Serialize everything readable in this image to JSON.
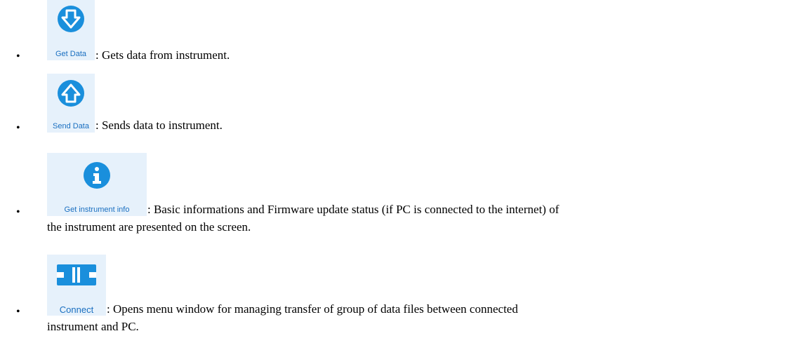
{
  "colors": {
    "icon_blue": "#1a8fdc",
    "icon_bg": "#e6f1fb",
    "label_blue": "#1a6fc0"
  },
  "items": [
    {
      "icon": "arrow-down-icon",
      "label": "Get Data",
      "description": ": Gets data from instrument."
    },
    {
      "icon": "arrow-up-icon",
      "label": "Send Data",
      "description": ": Sends data to instrument."
    },
    {
      "icon": "info-icon",
      "label": "Get instrument info",
      "description": ": Basic informations and Firmware update status (if PC is connected to the internet) of",
      "description_cont": "the instrument are presented on the screen."
    },
    {
      "icon": "plug-connect-icon",
      "label": "Connect",
      "description": ": Opens menu window for managing transfer of group of data files between connected",
      "description_cont": "instrument and PC."
    }
  ]
}
